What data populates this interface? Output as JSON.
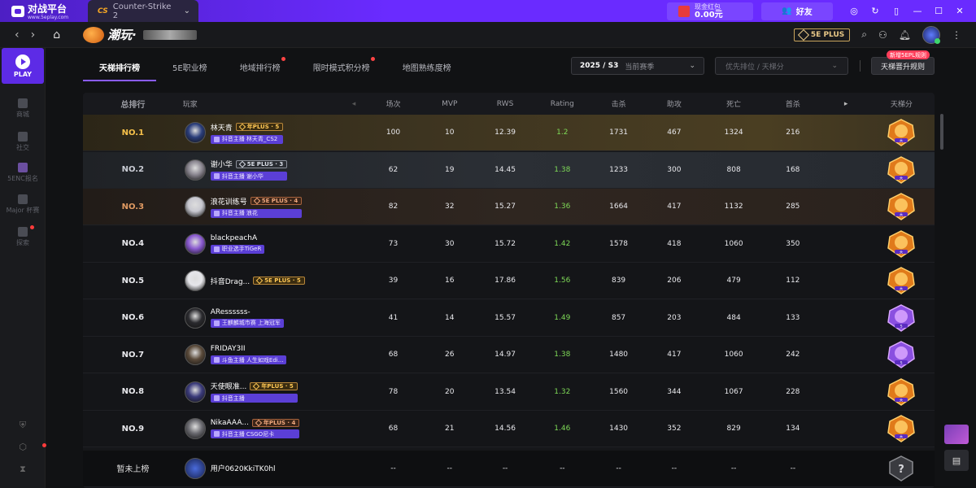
{
  "topbar": {
    "brand": "对战平台",
    "brand_sub": "www.5eplay.com",
    "game_tab": "Counter-Strike 2",
    "cash_label": "现金红包",
    "cash_value": "0.00元",
    "friend_label": "好友"
  },
  "navbar": {
    "brand": "潮玩·",
    "plus_label": "5E PLUS"
  },
  "sidebar": {
    "play": "PLAY",
    "items": [
      {
        "label": "商城"
      },
      {
        "label": "社交"
      },
      {
        "label": "5ENC报名"
      },
      {
        "label": "Major 杯赛"
      },
      {
        "label": "探索"
      }
    ]
  },
  "tabs": [
    {
      "label": "天梯排行榜",
      "active": true
    },
    {
      "label": "5E职业榜"
    },
    {
      "label": "地域排行榜",
      "dot": true
    },
    {
      "label": "限时模式积分榜",
      "dot": true
    },
    {
      "label": "地图熟练度榜"
    }
  ],
  "filters": {
    "season_value": "2025 / S3",
    "season_sub": "当前赛季",
    "rank_placeholder": "优先排位 / 天梯分",
    "rule_button": "天梯晋升规则",
    "rule_badge": "新增5EPL规则"
  },
  "table": {
    "headers": {
      "rank": "总排行",
      "player": "玩家",
      "games": "场次",
      "mvp": "MVP",
      "rws": "RWS",
      "rating": "Rating",
      "kills": "击杀",
      "assists": "助攻",
      "deaths": "死亡",
      "first": "首杀",
      "ladder": "天梯分"
    },
    "rows": [
      {
        "rank": "NO.1",
        "name": "林天青",
        "plus": "年PLUS · 5",
        "plus_style": "gold",
        "role": "抖音主播 林天青_CS2",
        "games": "100",
        "mvp": "10",
        "rws": "12.39",
        "rating": "1.2",
        "kills": "1731",
        "assists": "467",
        "deaths": "1324",
        "first": "216",
        "badge_label": "大",
        "avatar": "#2a3d7a"
      },
      {
        "rank": "NO.2",
        "name": "谢小华",
        "plus": "5E PLUS · 3",
        "plus_style": "silver",
        "role": "抖音主播 谢小华",
        "games": "62",
        "mvp": "19",
        "rws": "14.45",
        "rating": "1.38",
        "kills": "1233",
        "assists": "300",
        "deaths": "808",
        "first": "168",
        "badge_label": "大",
        "avatar": "#8a8690"
      },
      {
        "rank": "NO.3",
        "name": "浪花训练号",
        "plus": "5E PLUS · 4",
        "plus_style": "bronze",
        "role": "抖音主播 浪花",
        "games": "82",
        "mvp": "32",
        "rws": "15.27",
        "rating": "1.36",
        "kills": "1664",
        "assists": "417",
        "deaths": "1132",
        "first": "285",
        "badge_label": "大",
        "avatar": "#c8c8d0"
      },
      {
        "rank": "NO.4",
        "name": "blackpeachA",
        "plus": "",
        "plus_style": "",
        "role": "职业选手TiGeR",
        "games": "73",
        "mvp": "30",
        "rws": "15.72",
        "rating": "1.42",
        "kills": "1578",
        "assists": "418",
        "deaths": "1060",
        "first": "350",
        "badge_label": "大",
        "avatar": "#8a5ad0"
      },
      {
        "rank": "NO.5",
        "name": "抖音Drag...",
        "plus": "5E PLUS · 5",
        "plus_style": "gold",
        "role": "",
        "games": "39",
        "mvp": "16",
        "rws": "17.86",
        "rating": "1.56",
        "kills": "839",
        "assists": "206",
        "deaths": "479",
        "first": "112",
        "badge_label": "大",
        "avatar": "#e6e6ea"
      },
      {
        "rank": "NO.6",
        "name": "ARessssss-",
        "plus": "",
        "plus_style": "",
        "role": "王麒麟城市赛 上海冠军",
        "games": "41",
        "mvp": "14",
        "rws": "15.57",
        "rating": "1.49",
        "kills": "857",
        "assists": "203",
        "deaths": "484",
        "first": "133",
        "badge_label": "S",
        "avatar": "#2a2a2e"
      },
      {
        "rank": "NO.7",
        "name": "FRIDAY3II",
        "plus": "",
        "plus_style": "",
        "role": "斗鱼主播 人生如戏Edi...",
        "games": "68",
        "mvp": "26",
        "rws": "14.97",
        "rating": "1.38",
        "kills": "1480",
        "assists": "417",
        "deaths": "1060",
        "first": "242",
        "badge_label": "S",
        "avatar": "#5a4a3a"
      },
      {
        "rank": "NO.8",
        "name": "天使眼准...",
        "plus": "年PLUS · 5",
        "plus_style": "gold",
        "role": "抖音主播",
        "games": "78",
        "mvp": "20",
        "rws": "13.54",
        "rating": "1.32",
        "kills": "1560",
        "assists": "344",
        "deaths": "1067",
        "first": "228",
        "badge_label": "大",
        "avatar": "#3a3a7a"
      },
      {
        "rank": "NO.9",
        "name": "NikaAAA...",
        "plus": "年PLUS · 4",
        "plus_style": "bronze",
        "role": "抖音主播 CSGO尼卡",
        "games": "68",
        "mvp": "21",
        "rws": "14.56",
        "rating": "1.46",
        "kills": "1430",
        "assists": "352",
        "deaths": "829",
        "first": "134",
        "badge_label": "大",
        "avatar": "#6a6a70"
      }
    ],
    "me": {
      "rank": "暂未上榜",
      "name": "用户0620KkiTK0hl",
      "games": "--",
      "mvp": "--",
      "rws": "--",
      "rating": "--",
      "kills": "--",
      "assists": "--",
      "deaths": "--",
      "first": "--",
      "badge_label": "?"
    }
  },
  "colors": {
    "accent": "#6a2bff",
    "rating_green": "#7ed957",
    "rank1": "#f6c14a",
    "rank2": "#c9ccd4",
    "rank3": "#e09a62"
  }
}
